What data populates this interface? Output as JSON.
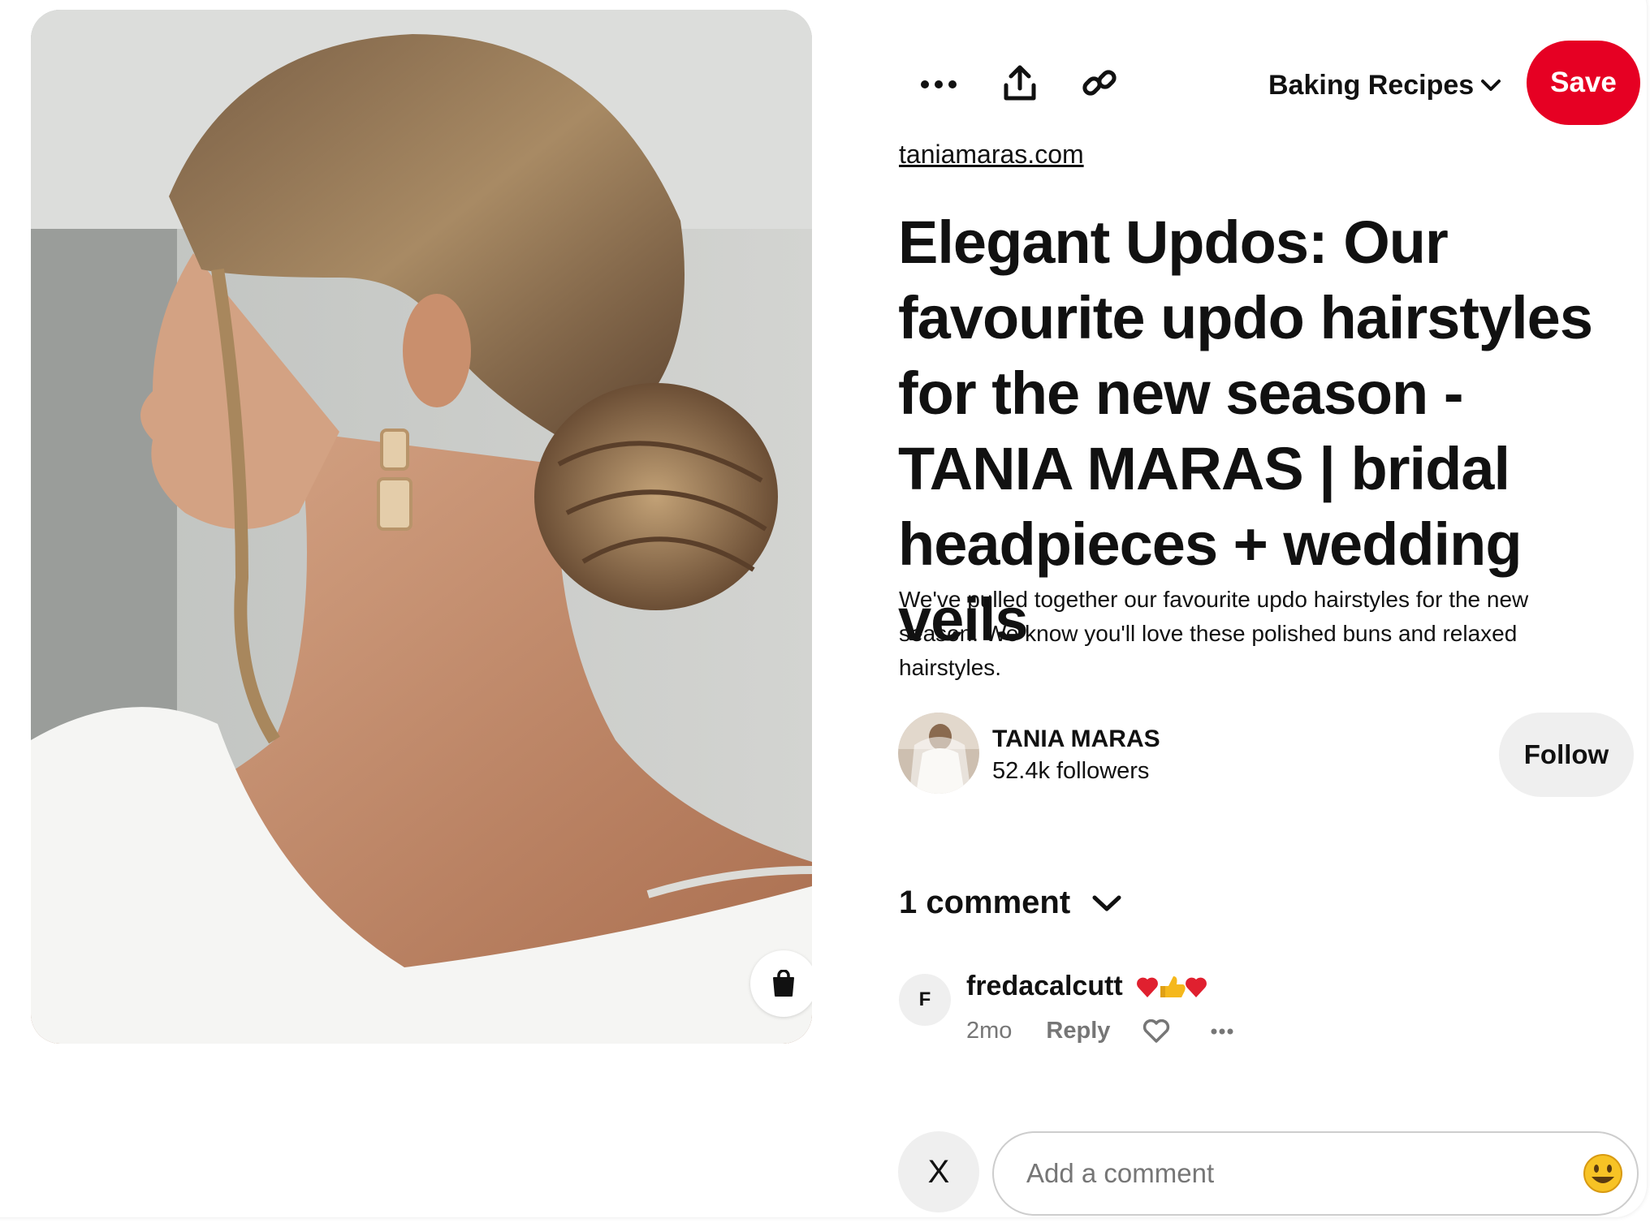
{
  "toolbar": {
    "more_icon": "ellipsis-icon",
    "share_icon": "share-upload-icon",
    "link_icon": "link-icon",
    "board_name": "Baking Recipes",
    "save_label": "Save",
    "save_color": "#e60023"
  },
  "pin": {
    "source": "taniamaras.com",
    "title": "Elegant Updos: Our favourite updo hairstyles for the new season - TANIA MARAS | bridal headpieces + wedding veils",
    "description": "We've pulled together our favourite updo hairstyles for the new season. We know you'll love these polished buns and relaxed hairstyles.",
    "shop_icon": "shopping-bag-icon"
  },
  "creator": {
    "name": "TANIA MARAS",
    "followers": "52.4k followers",
    "follow_label": "Follow"
  },
  "comments": {
    "count_label": "1 comment",
    "items": [
      {
        "avatar_letter": "F",
        "user": "fredacalcutt",
        "emoji": "♥👍♥",
        "time": "2mo",
        "reply_label": "Reply"
      }
    ]
  },
  "composer": {
    "avatar_letter": "X",
    "placeholder": "Add a comment",
    "emoji_icon": "smiley-icon"
  }
}
